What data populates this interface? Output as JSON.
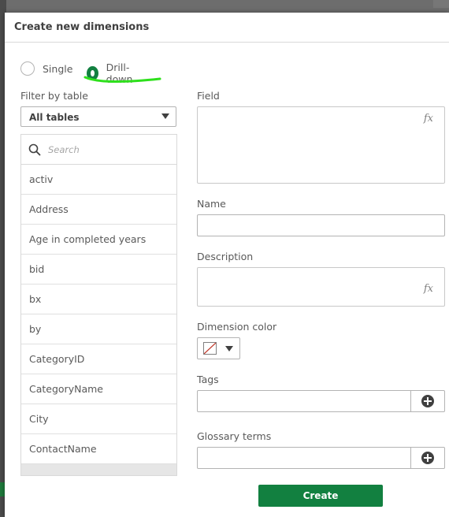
{
  "dialog": {
    "title": "Create new dimensions",
    "mode_options": [
      {
        "label": "Single",
        "selected": false
      },
      {
        "label": "Drill-down",
        "selected": true
      }
    ],
    "filter_label": "Filter by table",
    "filter_value": "All tables",
    "search_placeholder": "Search",
    "fields": [
      "activ",
      "Address",
      "Age in completed years",
      "bid",
      "bx",
      "by",
      "CategoryID",
      "CategoryName",
      "City",
      "ContactName"
    ],
    "field_label": "Field",
    "name_label": "Name",
    "description_label": "Description",
    "dimension_color_label": "Dimension color",
    "tags_label": "Tags",
    "glossary_label": "Glossary terms",
    "fx_symbol": "fx",
    "create_label": "Create"
  },
  "colors": {
    "accent": "#128040",
    "highlight_stroke": "#2ee01c"
  }
}
